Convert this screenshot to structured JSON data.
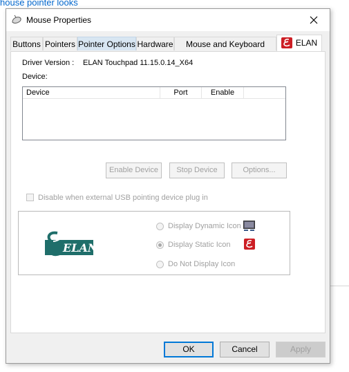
{
  "background": {
    "top_link": "house pointer looks"
  },
  "window": {
    "title": "Mouse Properties",
    "icon": "mouse-icon",
    "close_icon": "close-icon"
  },
  "tabs": [
    {
      "label": "Buttons"
    },
    {
      "label": "Pointers"
    },
    {
      "label": "Pointer Options"
    },
    {
      "label": "Hardware"
    },
    {
      "label": "Mouse and Keyboard Center"
    },
    {
      "label": "ELAN",
      "icon": "elan-icon",
      "active": true
    }
  ],
  "panel": {
    "driver_version_label": "Driver Version :",
    "driver_version_value": "ELAN Touchpad 11.15.0.14_X64",
    "device_label": "Device:",
    "list_columns": [
      "Device",
      "Port",
      "Enable"
    ],
    "buttons": {
      "enable_device": "Enable Device",
      "stop_device": "Stop Device",
      "options": "Options..."
    },
    "disable_checkbox_label": "Disable when external USB pointing device plug in",
    "disable_checked": false,
    "display_group": {
      "logo_text": "ELAN",
      "options": [
        {
          "label": "Display Dynamic Icon",
          "selected": false,
          "icon": "tray-monitor-icon"
        },
        {
          "label": "Display Static Icon",
          "selected": true,
          "icon": "elan-red-icon"
        },
        {
          "label": "Do Not Display Icon",
          "selected": false
        }
      ]
    }
  },
  "footer": {
    "ok": "OK",
    "cancel": "Cancel",
    "apply": "Apply"
  },
  "colors": {
    "accent": "#0078d7",
    "elan_red": "#cc1e24",
    "elan_teal": "#1f6e6a"
  }
}
